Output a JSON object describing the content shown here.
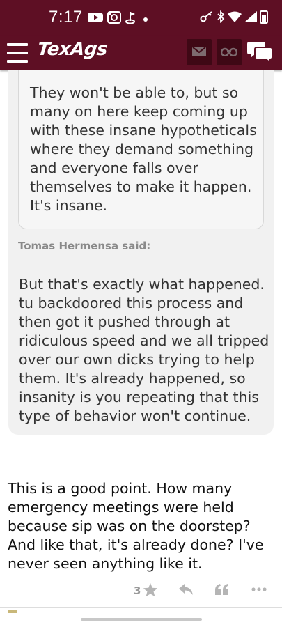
{
  "status_bar": {
    "time": "7:17",
    "background": "#5e0f24"
  },
  "app_bar": {
    "logo": "TexAgs",
    "background": "#5e0f24",
    "button_background": "#3f0815",
    "icons": [
      "menu-icon",
      "mail-icon",
      "binoculars-icon",
      "chat-bubbles-icon"
    ]
  },
  "quote": {
    "nested_text": "They won't be able to, but so many on here keep coming up with these insane hypotheticals where they demand something and everyone falls over themselves to make it happen. It's insane.",
    "author": "Tomas Hermensa",
    "said_suffix": "said:",
    "text": "But that's exactly what happened. tu backdoored this process and then got it pushed through at ridiculous speed and we all tripped over our own dicks trying to help them. It's already happened, so insanity is you repeating that this type of behavior won't continue."
  },
  "post": {
    "text": "This is a good point. How many emergency meetings were held because sip was on the doorstep? And like that, it's already done? I've never seen anything like it.",
    "like_count": "3",
    "action_icons": [
      "star-icon",
      "reply-icon",
      "quote-icon",
      "more-icon"
    ]
  }
}
